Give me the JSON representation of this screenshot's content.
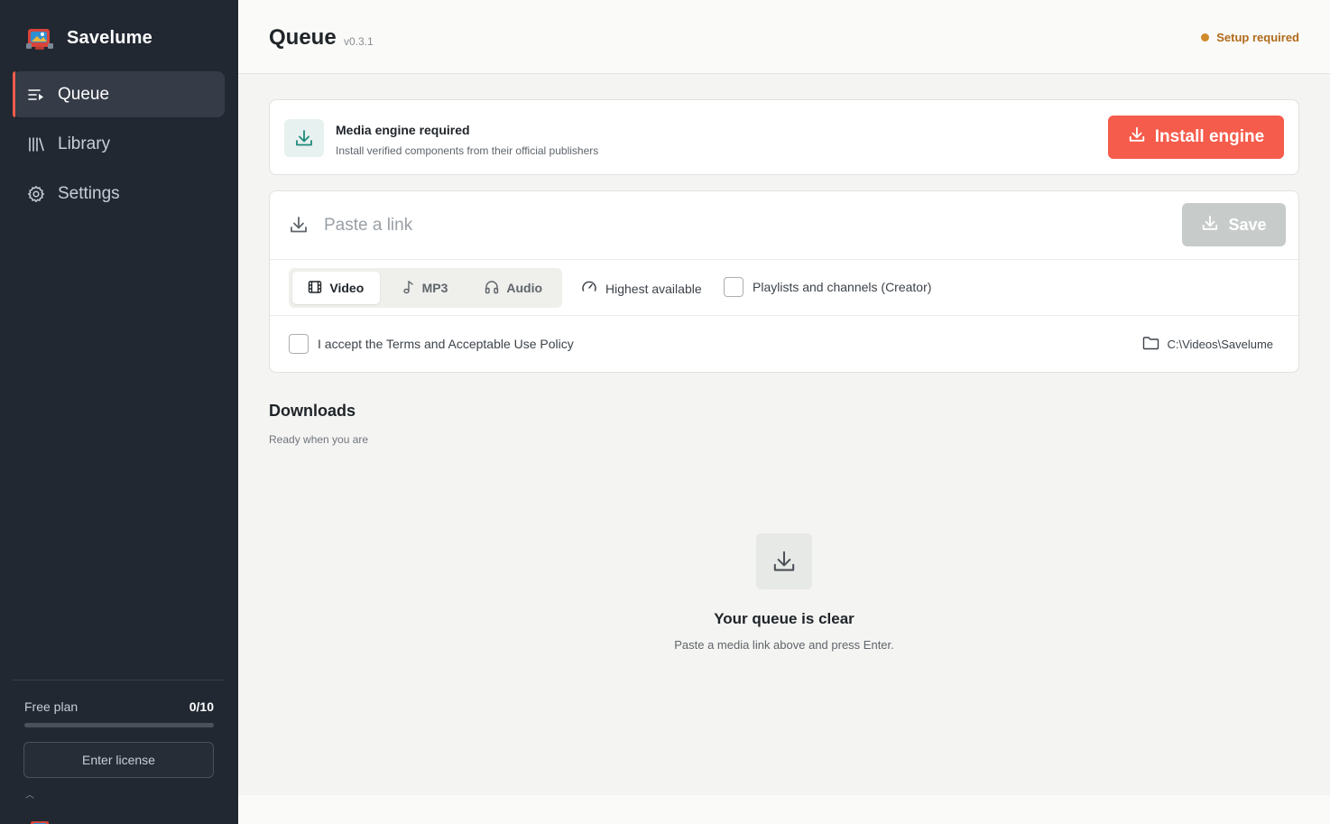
{
  "app": {
    "name": "Savelume",
    "logo_icon": "savelume-logo-icon",
    "accent_color": "#f55c4b"
  },
  "sidebar": {
    "items": [
      {
        "label": "Queue",
        "icon": "queue-icon",
        "active": true
      },
      {
        "label": "Library",
        "icon": "library-icon",
        "active": false
      },
      {
        "label": "Settings",
        "icon": "gear-icon",
        "active": false
      }
    ],
    "plan": {
      "label": "Free plan",
      "count": "0/10",
      "used_fraction": 0
    },
    "license_button": "Enter license"
  },
  "header": {
    "title": "Queue",
    "version": "v0.3.1",
    "status": "Setup required",
    "status_color": "#d08a2a"
  },
  "engine": {
    "title": "Media engine required",
    "subtitle": "Install verified components from their official publishers",
    "button": "Install engine"
  },
  "link": {
    "placeholder": "Paste a link",
    "save_button": "Save",
    "formats": [
      {
        "label": "Video",
        "icon": "film-icon",
        "active": true
      },
      {
        "label": "MP3",
        "icon": "music-note-icon",
        "active": false
      },
      {
        "label": "Audio",
        "icon": "headphones-icon",
        "active": false
      }
    ],
    "quality": "Highest available",
    "playlist_option": "Playlists and channels (Creator)",
    "terms": "I accept the Terms and Acceptable Use Policy",
    "folder": "C:\\Videos\\Savelume"
  },
  "downloads": {
    "title": "Downloads",
    "subtitle": "Ready when you are",
    "empty_title": "Your queue is clear",
    "empty_subtitle": "Paste a media link above and press Enter."
  }
}
